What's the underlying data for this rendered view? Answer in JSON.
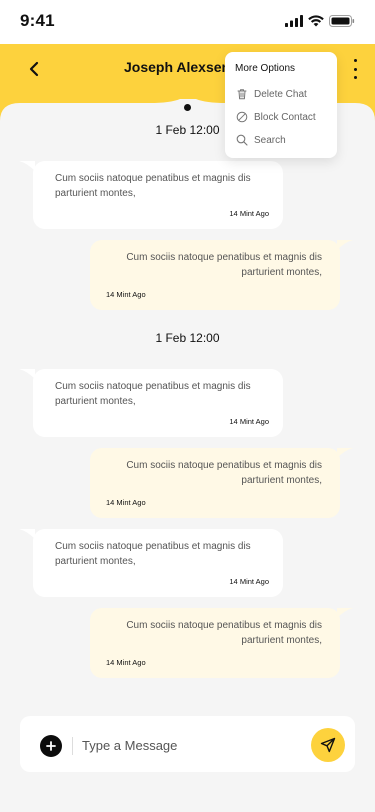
{
  "status_bar": {
    "time": "9:41"
  },
  "header": {
    "contact_name": "Joseph Alexsen",
    "accent_color": "#fdd23d"
  },
  "menu": {
    "title": "More Options",
    "items": [
      {
        "label": "Delete Chat",
        "icon": "trash-icon"
      },
      {
        "label": "Block Contact",
        "icon": "block-icon"
      },
      {
        "label": "Search",
        "icon": "search-icon"
      }
    ]
  },
  "chat": {
    "date_separators": [
      "1 Feb 12:00",
      "1 Feb 12:00"
    ],
    "messages": [
      {
        "direction": "incoming",
        "text": "Cum sociis natoque penatibus et magnis dis parturient montes,",
        "time": "14 Mint Ago"
      },
      {
        "direction": "outgoing",
        "text": "Cum sociis natoque penatibus et magnis dis parturient montes,",
        "time": "14 Mint Ago"
      },
      {
        "direction": "incoming",
        "text": "Cum sociis natoque penatibus et magnis dis parturient montes,",
        "time": "14 Mint Ago"
      },
      {
        "direction": "outgoing",
        "text": "Cum sociis natoque penatibus et magnis dis parturient montes,",
        "time": "14 Mint Ago"
      },
      {
        "direction": "incoming",
        "text": "Cum sociis natoque penatibus et magnis dis parturient montes,",
        "time": "14 Mint Ago"
      },
      {
        "direction": "outgoing",
        "text": "Cum sociis natoque penatibus et magnis dis parturient montes,",
        "time": "14 Mint Ago"
      }
    ]
  },
  "composer": {
    "placeholder": "Type a Message"
  }
}
